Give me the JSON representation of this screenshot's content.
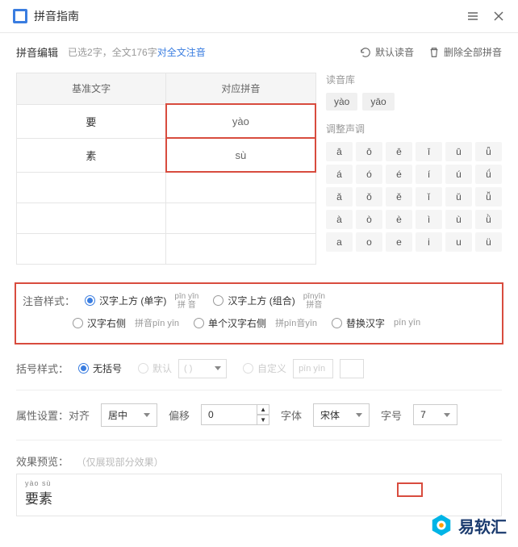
{
  "title": "拼音指南",
  "toolbar": {
    "edit_label": "拼音编辑",
    "info_text": "已选2字，全文176字 ",
    "link_text": "对全文注音",
    "default_reading": "默认读音",
    "delete_all": "删除全部拼音"
  },
  "char_table": {
    "col1": "基准文字",
    "col2": "对应拼音",
    "rows": [
      {
        "char": "要",
        "pinyin": "yào"
      },
      {
        "char": "素",
        "pinyin": "sù"
      }
    ]
  },
  "reading_bank": {
    "label": "读音库",
    "chips": [
      "yào",
      "yāo"
    ]
  },
  "tone_adjust": {
    "label": "调整声调",
    "cells": [
      "ā",
      "ō",
      "ē",
      "ī",
      "ū",
      "ǖ",
      "á",
      "ó",
      "é",
      "í",
      "ú",
      "ǘ",
      "ǎ",
      "ǒ",
      "ě",
      "ǐ",
      "ǔ",
      "ǚ",
      "à",
      "ò",
      "è",
      "ì",
      "ù",
      "ǜ",
      "a",
      "o",
      "e",
      "i",
      "u",
      "ü"
    ]
  },
  "style": {
    "label": "注音样式：",
    "opt1": "汉字上方 (单字)",
    "opt1_sample_top": "pīn yīn",
    "opt1_sample_bot": "拼 音",
    "opt2": "汉字上方 (组合)",
    "opt2_sample_top": "pīnyīn",
    "opt2_sample_bot": "拼音",
    "opt3": "汉字右侧",
    "opt3_sample": "拼音pīn yīn",
    "opt4": "单个汉字右侧",
    "opt4_sample": "拼pīn音yīn",
    "opt5": "替换汉字",
    "opt5_sample": "pīn yīn"
  },
  "bracket": {
    "label": "括号样式：",
    "opt1": "无括号",
    "opt2": "默认",
    "opt2_sample": "( )",
    "opt3": "自定义",
    "opt3_sample": "pīn yīn"
  },
  "props": {
    "align_label": "属性设置：对齐",
    "align_value": "居中",
    "offset_label": "偏移",
    "offset_value": "0",
    "font_label": "字体",
    "font_value": "宋体",
    "size_label": "字号",
    "size_value": "7"
  },
  "preview": {
    "label": "效果预览：",
    "note": "（仅展现部分效果）",
    "pinyin": "yào sù",
    "chars": "要素"
  },
  "brand": "易软汇"
}
